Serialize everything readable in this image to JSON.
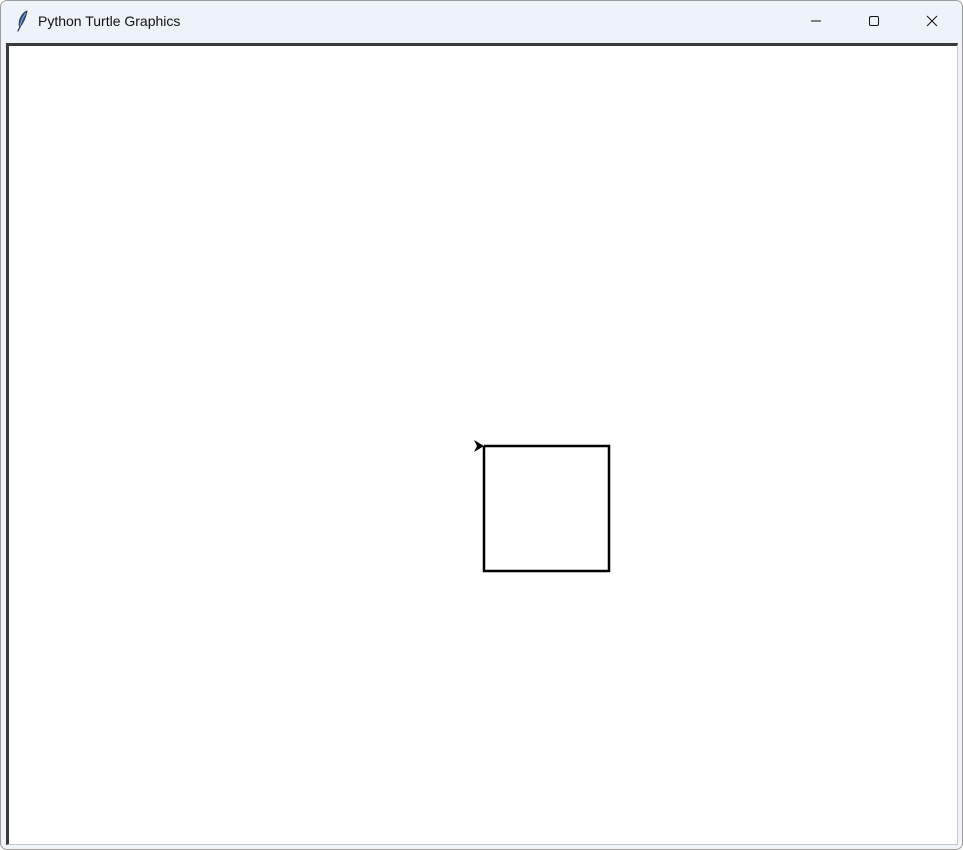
{
  "window": {
    "title": "Python Turtle Graphics",
    "app_icon": "feather-icon",
    "controls": {
      "minimize": "minimize-icon",
      "maximize": "maximize-icon",
      "close": "close-icon"
    }
  },
  "canvas": {
    "background": "#ffffff",
    "pen_color": "#000000",
    "drawing": {
      "shape": "square",
      "side_length": 125,
      "start": [
        0,
        0
      ],
      "path": [
        [
          0,
          0
        ],
        [
          125,
          0
        ],
        [
          125,
          -125
        ],
        [
          0,
          -125
        ],
        [
          0,
          0
        ]
      ]
    },
    "turtle": {
      "shape": "arrow-icon",
      "position": [
        0,
        0
      ],
      "heading": 0
    }
  }
}
